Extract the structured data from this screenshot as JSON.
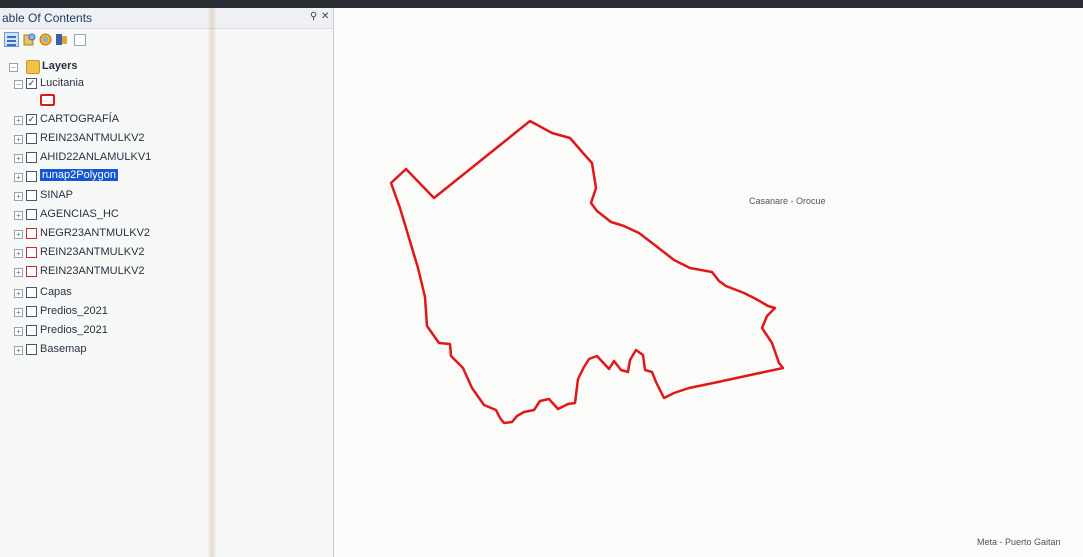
{
  "toc": {
    "title": "able Of Contents",
    "pin_glyph": "⚲",
    "close_glyph": "✕",
    "toolbar": [
      "list-by-drawing-order-icon",
      "list-by-source-icon",
      "list-by-visibility-icon",
      "list-by-selection-icon",
      "options-icon"
    ],
    "layers_label": "Layers",
    "layers": [
      {
        "name": "Lucitania",
        "checked": true,
        "expanded": true
      },
      {
        "name": "CARTOGRAFÍA",
        "checked": true
      },
      {
        "name": "REIN23ANTMULKV2",
        "checked": false
      },
      {
        "name": "AHID22ANLAMULKV1",
        "checked": false
      },
      {
        "name": "runap2Polygon",
        "checked": false,
        "selected": true
      },
      {
        "name": "SINAP",
        "checked": false
      },
      {
        "name": "AGENCIAS_HC",
        "checked": false
      },
      {
        "name": "NEGR23ANTMULKV2",
        "checked": false,
        "partial": true
      },
      {
        "name": "REIN23ANTMULKV2",
        "checked": false,
        "partial": true
      },
      {
        "name": "REIN23ANTMULKV2",
        "checked": false,
        "partial": true
      },
      {
        "name": "Capas",
        "checked": false
      },
      {
        "name": "Predios_2021",
        "checked": false
      },
      {
        "name": "Predios_2021",
        "checked": false
      },
      {
        "name": "Basemap",
        "checked": false
      }
    ]
  },
  "map": {
    "labels": {
      "casanare": "Casanare - Orocue",
      "meta": "Meta - Puerto Gaitan"
    },
    "polygon_color": "#e01818"
  }
}
